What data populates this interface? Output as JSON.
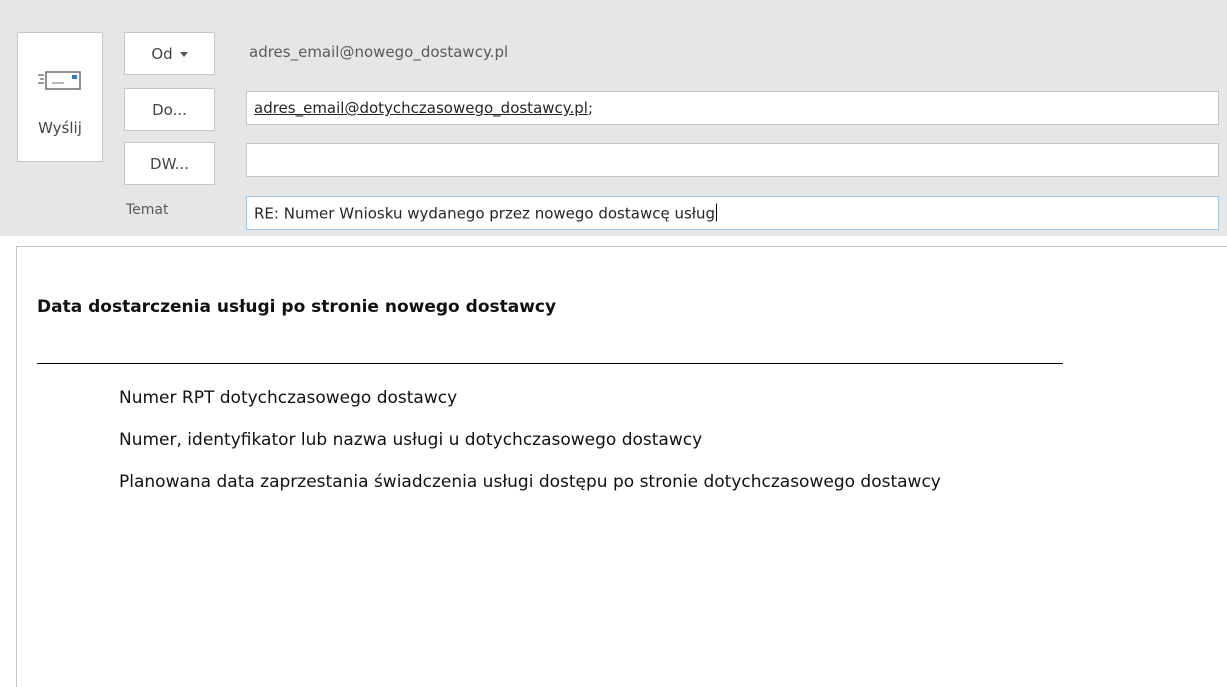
{
  "compose": {
    "send_label": "Wyślij",
    "from_button": "Od",
    "from_value": "adres_email@nowego_dostawcy.pl",
    "to_button": "Do...",
    "to_value": "adres_email@dotychczasowego_dostawcy.pl",
    "to_separator": ";",
    "cc_button": "DW...",
    "cc_value": "",
    "subject_label": "Temat",
    "subject_value": "RE: Numer Wniosku wydanego przez nowego dostawcę usług"
  },
  "body": {
    "heading": "Data dostarczenia usługi po stronie nowego dostawcy",
    "lines": [
      "Numer RPT dotychczasowego dostawcy",
      "Numer, identyfikator lub nazwa usługi u dotychczasowego dostawcy",
      "Planowana data zaprzestania świadczenia usługi dostępu po stronie dotychczasowego dostawcy"
    ]
  },
  "icons": {
    "send": "envelope-send-icon",
    "from_dropdown": "chevron-down-icon"
  },
  "colors": {
    "header_bg": "#e6e6e6",
    "active_field_border": "#9cc8ec"
  }
}
